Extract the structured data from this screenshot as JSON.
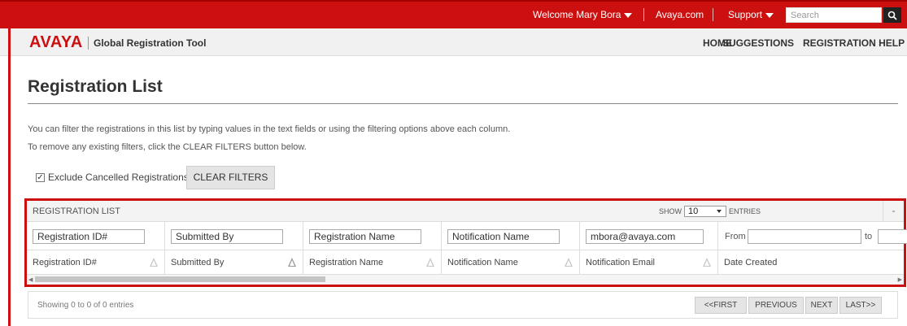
{
  "topbar": {
    "welcome": "Welcome Mary Bora",
    "avaya_link": "Avaya.com",
    "support": "Support",
    "search_placeholder": "Search"
  },
  "header": {
    "logo": "AVAYA",
    "app_title": "Global Registration Tool",
    "nav": [
      "HOME",
      "SUGGESTIONS",
      "REGISTRATION HELP"
    ]
  },
  "page": {
    "title": "Registration List",
    "instructions": [
      "You can filter the registrations in this list by typing values in the text fields or using the filtering options above each column.",
      "To remove any existing filters, click the CLEAR FILTERS button below."
    ],
    "exclude_label": "Exclude Cancelled Registrations",
    "clear_filters": "CLEAR FILTERS"
  },
  "panel": {
    "label": "REGISTRATION LIST",
    "show_label": "SHOW",
    "entries_value": "10",
    "entries_label": "ENTRIES",
    "collapse": "-",
    "filters": {
      "registration_id": "Registration ID#",
      "submitted_by": "Submitted By",
      "registration_name": "Registration Name",
      "notification_name": "Notification Name",
      "notification_email": "mbora@avaya.com",
      "from_label": "From",
      "to_label": "to"
    },
    "columns": [
      "Registration ID#",
      "Submitted By",
      "Registration Name",
      "Notification Name",
      "Notification Email",
      "Date Created"
    ]
  },
  "footer": {
    "showing": "Showing 0 to 0 of 0 entries",
    "first": "<<FIRST",
    "previous": "PREVIOUS",
    "next": "NEXT",
    "last": "LAST>>"
  },
  "colors": {
    "brand_red": "#cc1010"
  }
}
